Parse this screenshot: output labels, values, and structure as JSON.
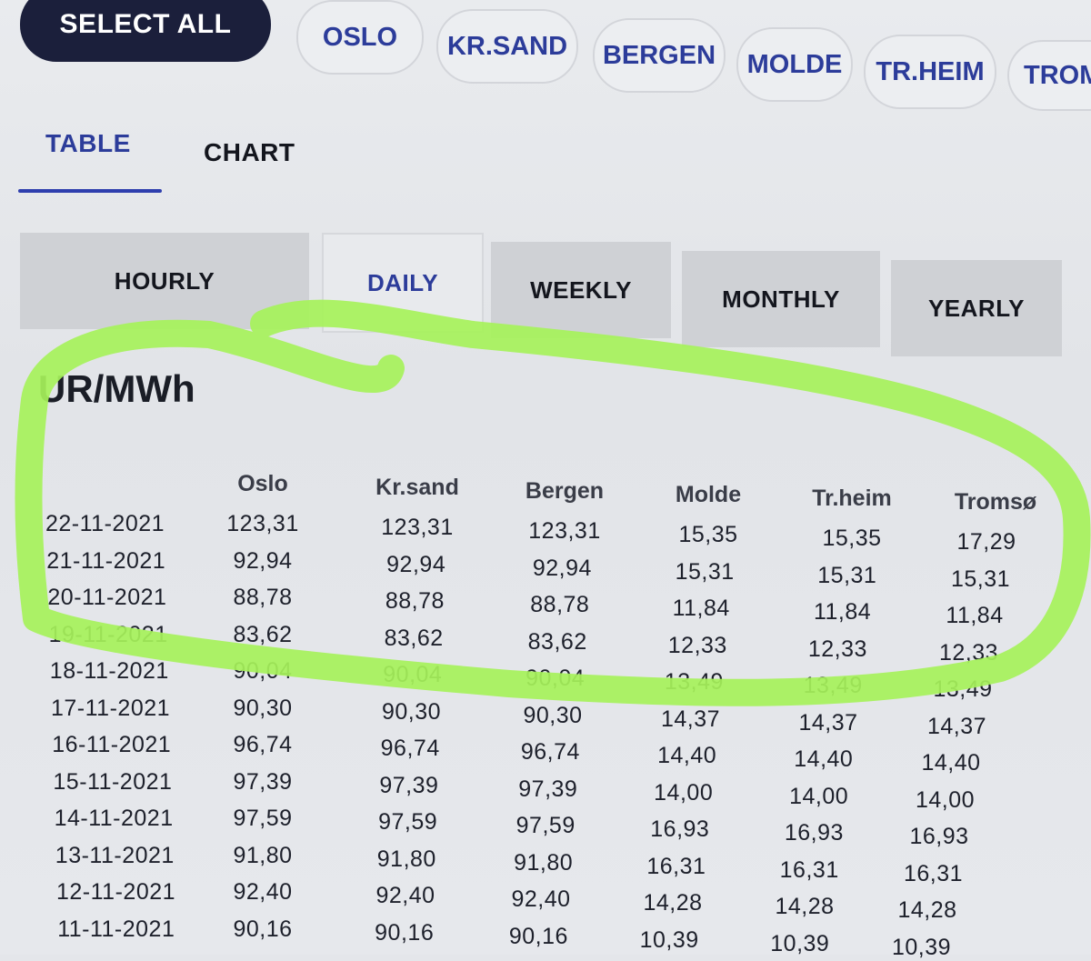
{
  "area_filter": {
    "select_all_label": "SELECT ALL",
    "areas": [
      "OSLO",
      "KR.SAND",
      "BERGEN",
      "MOLDE",
      "TR.HEIM",
      "TROMS"
    ]
  },
  "view_tabs": {
    "table_label": "TABLE",
    "chart_label": "CHART"
  },
  "periods": {
    "hourly": "HOURLY",
    "daily": "DAILY",
    "weekly": "WEEKLY",
    "monthly": "MONTHLY",
    "yearly": "YEARLY",
    "selected": "DAILY"
  },
  "unit_label": "UR/MWh",
  "table": {
    "columns": [
      "Oslo",
      "Kr.sand",
      "Bergen",
      "Molde",
      "Tr.heim",
      "Tromsø"
    ],
    "rows": [
      {
        "date": "22-11-2021",
        "values": [
          "123,31",
          "123,31",
          "123,31",
          "15,35",
          "15,35",
          "17,29"
        ]
      },
      {
        "date": "21-11-2021",
        "values": [
          "92,94",
          "92,94",
          "92,94",
          "15,31",
          "15,31",
          "15,31"
        ]
      },
      {
        "date": "20-11-2021",
        "values": [
          "88,78",
          "88,78",
          "88,78",
          "11,84",
          "11,84",
          "11,84"
        ]
      },
      {
        "date": "19-11-2021",
        "values": [
          "83,62",
          "83,62",
          "83,62",
          "12,33",
          "12,33",
          "12,33"
        ]
      },
      {
        "date": "18-11-2021",
        "values": [
          "90,04",
          "90,04",
          "90,04",
          "13,49",
          "13,49",
          "13,49"
        ]
      },
      {
        "date": "17-11-2021",
        "values": [
          "90,30",
          "90,30",
          "90,30",
          "14,37",
          "14,37",
          "14,37"
        ]
      },
      {
        "date": "16-11-2021",
        "values": [
          "96,74",
          "96,74",
          "96,74",
          "14,40",
          "14,40",
          "14,40"
        ]
      },
      {
        "date": "15-11-2021",
        "values": [
          "97,39",
          "97,39",
          "97,39",
          "14,00",
          "14,00",
          "14,00"
        ]
      },
      {
        "date": "14-11-2021",
        "values": [
          "97,59",
          "97,59",
          "97,59",
          "16,93",
          "16,93",
          "16,93"
        ]
      },
      {
        "date": "13-11-2021",
        "values": [
          "91,80",
          "91,80",
          "91,80",
          "16,31",
          "16,31",
          "16,31"
        ]
      },
      {
        "date": "12-11-2021",
        "values": [
          "92,40",
          "92,40",
          "92,40",
          "14,28",
          "14,28",
          "14,28"
        ]
      },
      {
        "date": "11-11-2021",
        "values": [
          "90,16",
          "90,16",
          "90,16",
          "10,39",
          "10,39",
          "10,39"
        ]
      }
    ]
  },
  "colors": {
    "accent": "#2c3c9a",
    "select_all_bg": "#1b1f3b",
    "highlighter": "#a6f25a"
  }
}
